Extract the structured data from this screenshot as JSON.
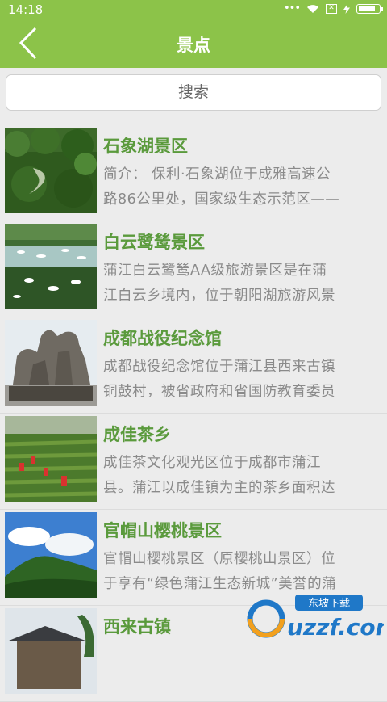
{
  "status_bar": {
    "time": "14:18",
    "battery_level": 0.85
  },
  "header": {
    "title": "景点",
    "back_icon": "chevron-left-icon"
  },
  "search": {
    "label": "搜索"
  },
  "spots": [
    {
      "name": "石象湖景区",
      "desc_line1": "简介：  保利·石象湖位于成雅高速公",
      "desc_line2": "路86公里处，国家级生态示范区——",
      "image": "forest-lake"
    },
    {
      "name": "白云鹭鸶景区",
      "desc_line1": "蒲江白云鹭鸶AA级旅游景区是在蒲",
      "desc_line2": "江白云乡境内，位于朝阳湖旅游风景",
      "image": "egrets-lake"
    },
    {
      "name": "成都战役纪念馆",
      "desc_line1": "成都战役纪念馆位于蒲江县西来古镇",
      "desc_line2": "铜鼓村，被省政府和省国防教育委员",
      "image": "statue"
    },
    {
      "name": "成佳茶乡",
      "desc_line1": "成佳茶文化观光区位于成都市蒲江",
      "desc_line2": "县。蒲江以成佳镇为主的茶乡面积达",
      "image": "tea-field"
    },
    {
      "name": "官帽山樱桃景区",
      "desc_line1": "官帽山樱桃景区（原樱桃山景区）位",
      "desc_line2": "于享有“绿色蒲江生态新城”美誉的蒲",
      "image": "mountain-sky"
    },
    {
      "name": "西来古镇",
      "desc_line1": "",
      "desc_line2": "",
      "image": "old-town"
    }
  ],
  "watermark": {
    "brand": "东坡下载",
    "site": "uzzf.com"
  },
  "colors": {
    "accent": "#8cc349",
    "title_green": "#5a9a3c",
    "desc_gray": "#8a8a8a"
  }
}
